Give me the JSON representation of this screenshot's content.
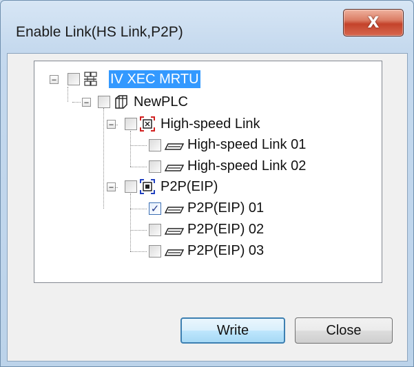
{
  "window": {
    "title": "Enable Link(HS Link,P2P)",
    "close_glyph": "X"
  },
  "tree": {
    "root": {
      "label": "IV XEC MRTU",
      "icon": "network-icon",
      "selected": true,
      "checked": false,
      "expanded": true
    },
    "plc": {
      "label": "NewPLC",
      "icon": "plc-module-icon",
      "checked": false,
      "expanded": true
    },
    "hs_group": {
      "label": "High-speed Link",
      "icon": "hs-link-group-icon",
      "checked": false,
      "expanded": true
    },
    "hs_items": [
      {
        "label": "High-speed Link 01",
        "checked": false
      },
      {
        "label": "High-speed Link 02",
        "checked": false
      }
    ],
    "p2p_group": {
      "label": "P2P(EIP)",
      "icon": "p2p-group-icon",
      "checked": false,
      "expanded": true
    },
    "p2p_items": [
      {
        "label": "P2P(EIP) 01",
        "checked": true
      },
      {
        "label": "P2P(EIP) 02",
        "checked": false
      },
      {
        "label": "P2P(EIP) 03",
        "checked": false
      }
    ]
  },
  "buttons": {
    "write_label": "Write",
    "close_label": "Close"
  },
  "expander_glyph": "−",
  "check_glyph": "✓",
  "colors": {
    "selection": "#3399ff",
    "hs_icon_accent": "#d22020",
    "p2p_icon_accent": "#2040c0"
  }
}
